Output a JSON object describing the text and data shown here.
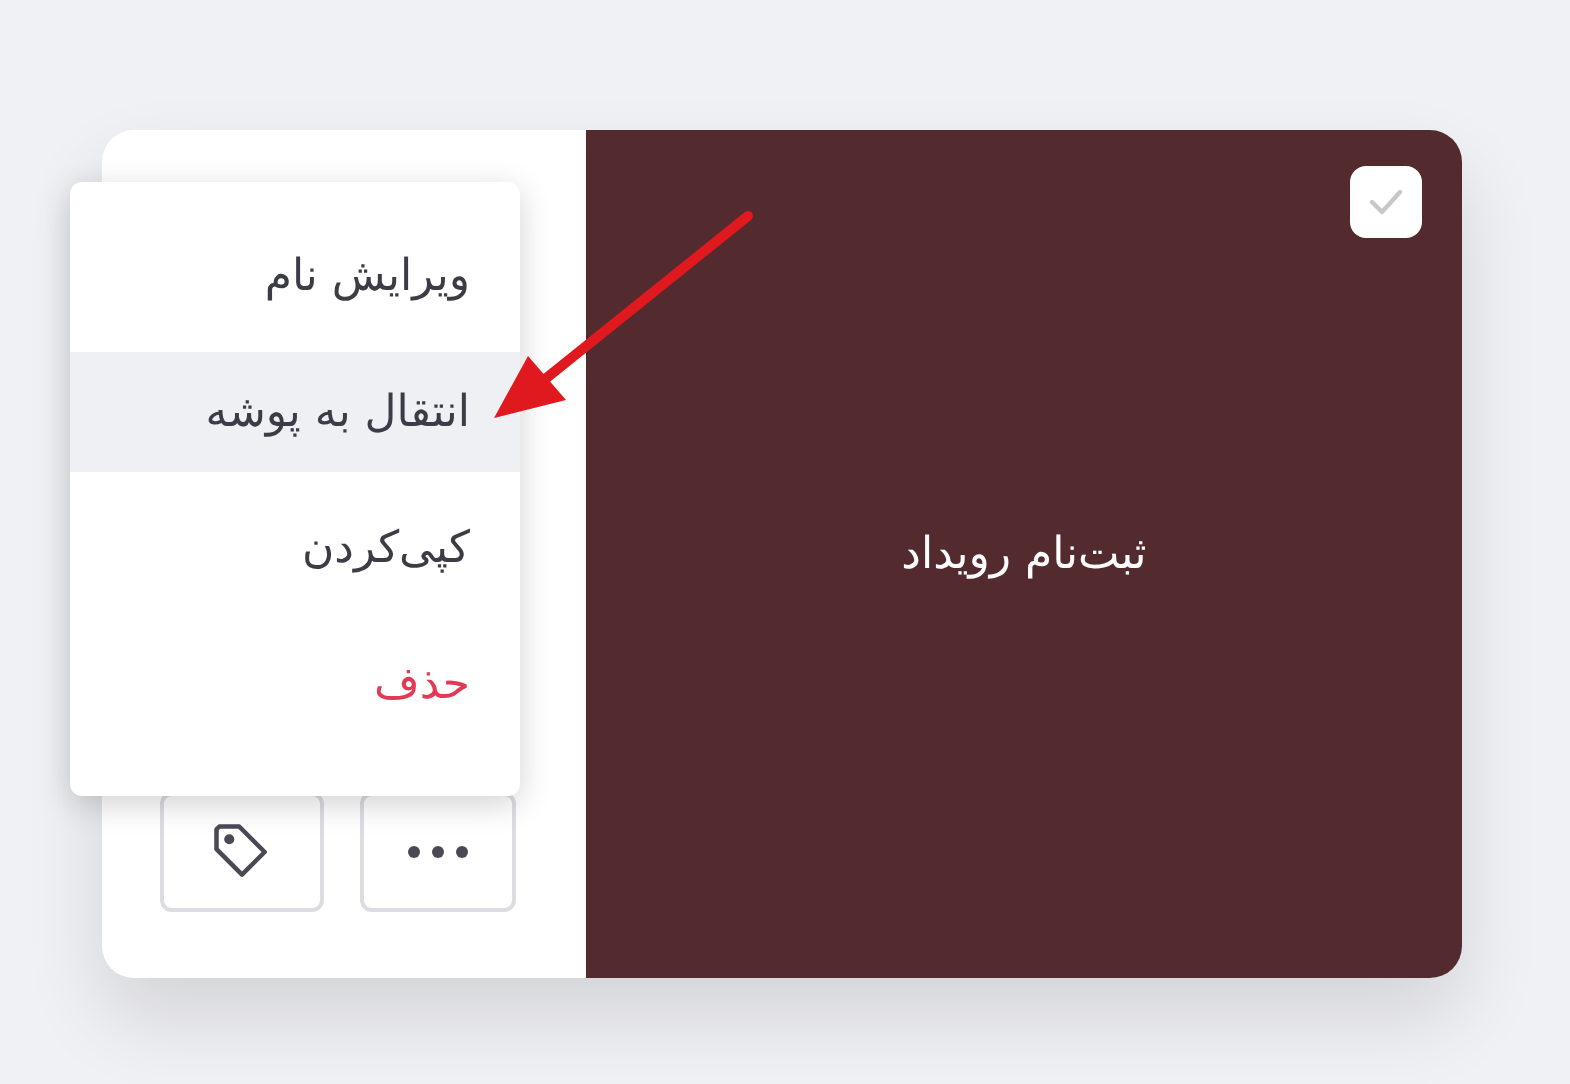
{
  "card": {
    "title": "ثبت‌نام رویداد",
    "checkbox": {
      "checked": false
    }
  },
  "menu": {
    "items": [
      {
        "label": "ویرایش نام",
        "kind": "normal",
        "selected": false
      },
      {
        "label": "انتقال به پوشه",
        "kind": "normal",
        "selected": true
      },
      {
        "label": "کپی‌کردن",
        "kind": "normal",
        "selected": false
      },
      {
        "label": "حذف",
        "kind": "danger",
        "selected": false
      }
    ]
  }
}
